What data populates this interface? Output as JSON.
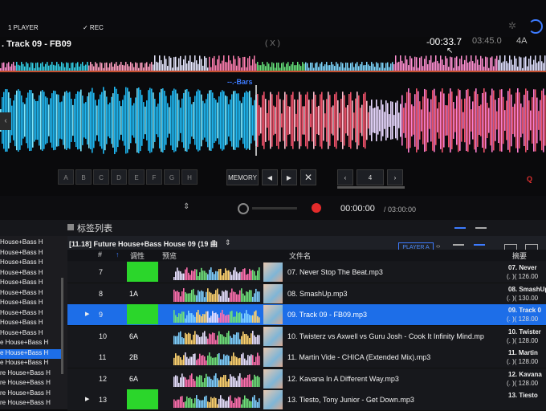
{
  "deck": {
    "mode_label": "1 PLAYER",
    "rec_label": "✓ REC",
    "track_title": ". Track 09 - FB09",
    "center_indicator": "( X )",
    "elapsed": "-00:33.7",
    "remaining": "03:45.0",
    "key": "4A",
    "bars_label": "--.-Bars"
  },
  "hot_cues": [
    "A",
    "B",
    "C",
    "D",
    "E",
    "F",
    "G",
    "H"
  ],
  "controls": {
    "memory_label": "MEMORY",
    "beat_jump_value": "4",
    "quantize_label": "Q"
  },
  "transport": {
    "record_time": "00:00:00",
    "record_total": "/ 03:00:00"
  },
  "browser": {
    "panel_title": "标签列表",
    "playlist_name": "[11.18] Future House+Bass House 09 (19 曲",
    "player_target": "PLAYER A",
    "columns": {
      "num": "#",
      "key": "调性",
      "preview": "预览",
      "filename": "文件名",
      "summary": "摘要"
    },
    "sidebar_items": [
      "House+Bass H",
      "House+Bass H",
      "House+Bass H",
      "House+Bass H",
      "House+Bass H",
      "House+Bass H",
      "House+Bass H",
      "House+Bass H",
      "House+Bass H",
      "House+Bass H",
      "e House+Bass H",
      "e House+Bass H",
      "e House+Bass H",
      "re House+Bass H",
      "re House+Bass H",
      "re House+Bass H",
      "re House+Bass H"
    ],
    "rows": [
      {
        "num": "7",
        "key": "",
        "key_color": "#2bd62b",
        "filename": "07. Never Stop The Beat.mp3",
        "summary": "07. Never",
        "bpm": "(. )(  126.00",
        "play": ""
      },
      {
        "num": "8",
        "key": "1A",
        "key_color": "",
        "filename": "08. SmashUp.mp3",
        "summary": "08. SmashUp",
        "bpm": "(. )(  130.00",
        "play": ""
      },
      {
        "num": "9",
        "key": "",
        "key_color": "#2bd62b",
        "filename": "09. Track 09 - FB09.mp3",
        "summary": "09. Track 0",
        "bpm": "(. )(  128.00",
        "play": "▶"
      },
      {
        "num": "10",
        "key": "6A",
        "key_color": "",
        "filename": "10. Twisterz vs Axwell vs Guru Josh - Cook It Infinity Mind.mp",
        "summary": "10. Twister",
        "bpm": "(. )(  128.00",
        "play": ""
      },
      {
        "num": "11",
        "key": "2B",
        "key_color": "",
        "filename": "11. Martin Vide - CHICA (Extended Mix).mp3",
        "summary": "11. Martin",
        "bpm": "(. )(  128.00",
        "play": ""
      },
      {
        "num": "12",
        "key": "6A",
        "key_color": "",
        "filename": "12. Kavana In A Different Way.mp3",
        "summary": "12. Kavana",
        "bpm": "(. )(  128.00",
        "play": ""
      },
      {
        "num": "13",
        "key": "",
        "key_color": "#2bd62b",
        "filename": "13. Tiesto, Tony Junior - Get Down.mp3",
        "summary": "13. Tiesto",
        "bpm": "",
        "play": "▶"
      }
    ]
  },
  "colors": {
    "accent": "#1d6ee8",
    "key_green": "#2bd62b",
    "record_red": "#e32b2b",
    "wave_blue": "#1fb6f0",
    "wave_red": "#f0526b"
  }
}
